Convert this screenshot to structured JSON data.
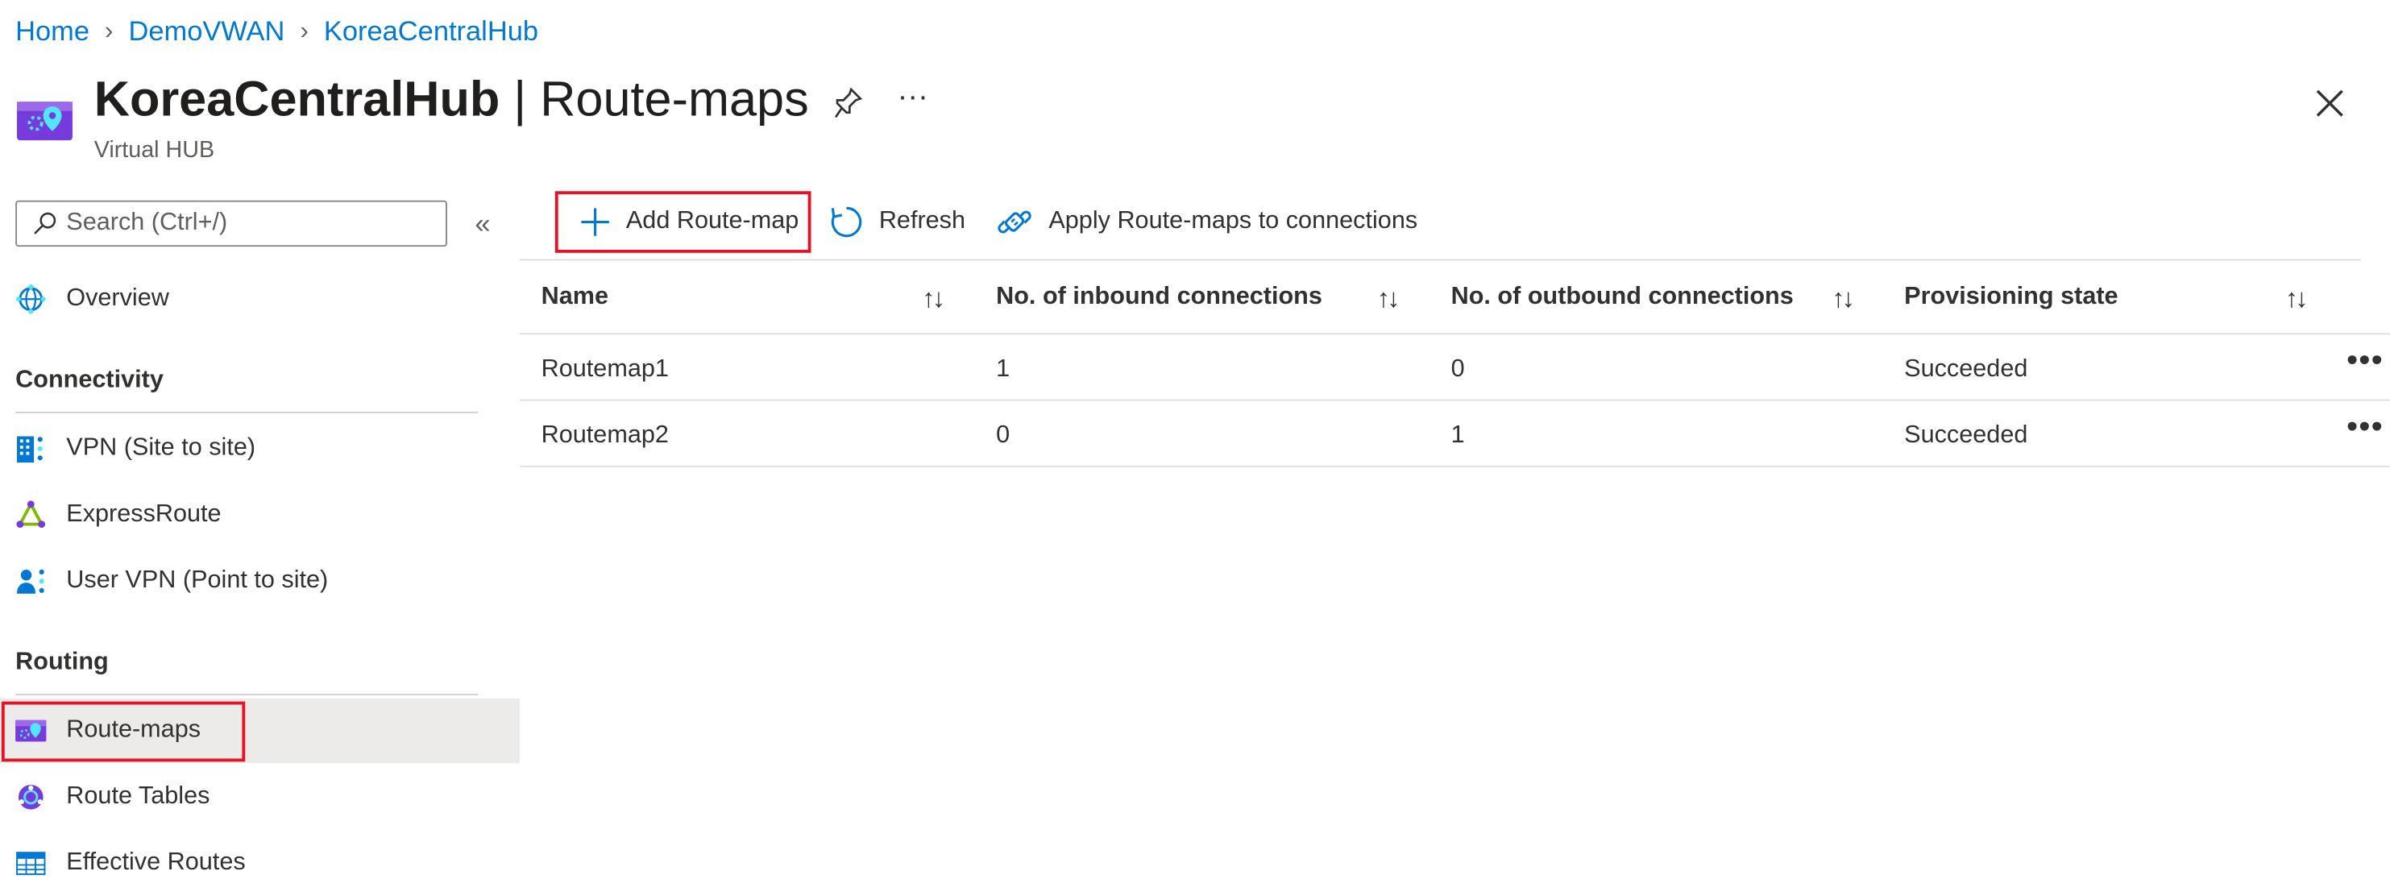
{
  "breadcrumb": [
    "Home",
    "DemoVWAN",
    "KoreaCentralHub"
  ],
  "header": {
    "resource_name": "KoreaCentralHub",
    "separator": " | ",
    "page_name": "Route-maps",
    "subtitle": "Virtual HUB",
    "more_label": "···"
  },
  "sidebar": {
    "search_placeholder": "Search (Ctrl+/)",
    "collapse_label": "«",
    "overview": "Overview",
    "sections": [
      {
        "title": "Connectivity",
        "items": [
          "VPN (Site to site)",
          "ExpressRoute",
          "User VPN (Point to site)"
        ]
      },
      {
        "title": "Routing",
        "items": [
          "Route-maps",
          "Route Tables",
          "Effective Routes"
        ]
      }
    ]
  },
  "toolbar": {
    "add_label": "Add Route-map",
    "refresh_label": "Refresh",
    "apply_label": "Apply Route-maps to connections"
  },
  "table": {
    "columns": [
      "Name",
      "No. of inbound connections",
      "No. of outbound connections",
      "Provisioning state"
    ],
    "sort_glyph": "↑↓",
    "row_menu": "•••",
    "rows": [
      [
        "Routemap1",
        "1",
        "0",
        "Succeeded"
      ],
      [
        "Routemap2",
        "0",
        "1",
        "Succeeded"
      ]
    ]
  },
  "colors": {
    "accent": "#0078d4",
    "highlight": "#e81123",
    "active_bg": "#edebe9"
  }
}
